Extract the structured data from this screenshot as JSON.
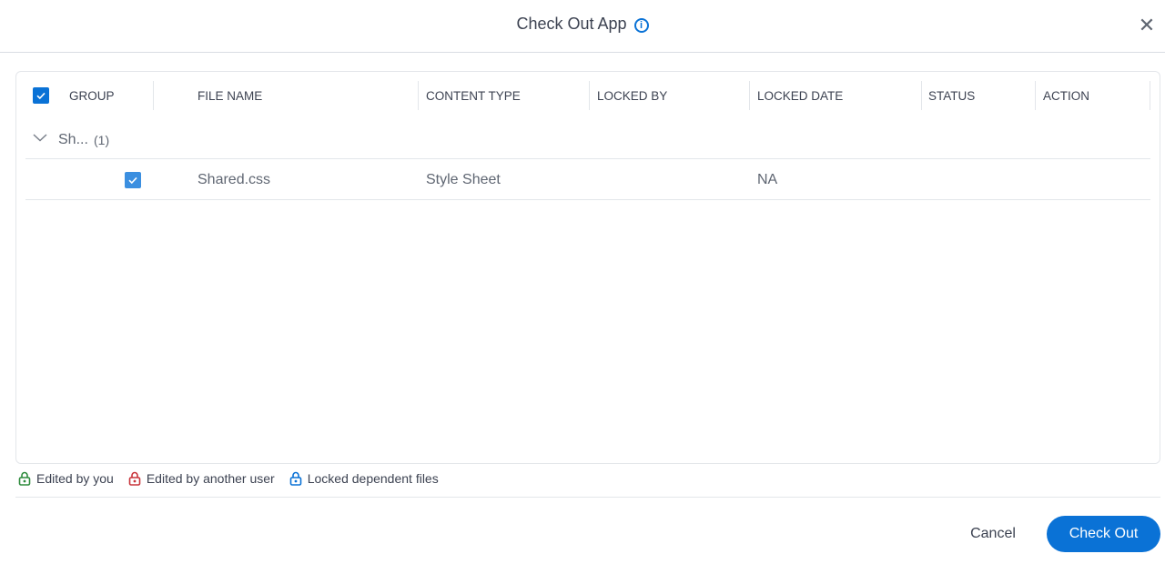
{
  "dialog": {
    "title": "Check Out App",
    "info_icon": "info-circle-icon",
    "close_icon": "close-icon"
  },
  "grid": {
    "columns": [
      {
        "key": "group",
        "label": "GROUP"
      },
      {
        "key": "file_name",
        "label": "FILE NAME"
      },
      {
        "key": "content_type",
        "label": "CONTENT TYPE"
      },
      {
        "key": "locked_by",
        "label": "LOCKED BY"
      },
      {
        "key": "locked_date",
        "label": "LOCKED DATE"
      },
      {
        "key": "status",
        "label": "STATUS"
      },
      {
        "key": "action",
        "label": "ACTION"
      }
    ],
    "select_all_checked": true,
    "groups": [
      {
        "name": "Sh...",
        "count": "(1)",
        "expanded": true,
        "rows": [
          {
            "checked": true,
            "file_name": "Shared.css",
            "content_type": "Style Sheet",
            "locked_by": "",
            "locked_date": "NA",
            "status": "",
            "action": ""
          }
        ]
      }
    ]
  },
  "legend": [
    {
      "icon": "lock-green-icon",
      "label": "Edited by you",
      "color": "#2e8b3d"
    },
    {
      "icon": "lock-red-icon",
      "label": "Edited by another user",
      "color": "#c9353b"
    },
    {
      "icon": "lock-blue-icon",
      "label": "Locked dependent files",
      "color": "#0a72d6"
    }
  ],
  "footer": {
    "cancel_label": "Cancel",
    "checkout_label": "Check Out"
  },
  "colors": {
    "accent": "#0a72d6",
    "text": "#3c4251",
    "muted": "#5f6672",
    "border": "#e3e6ea"
  }
}
